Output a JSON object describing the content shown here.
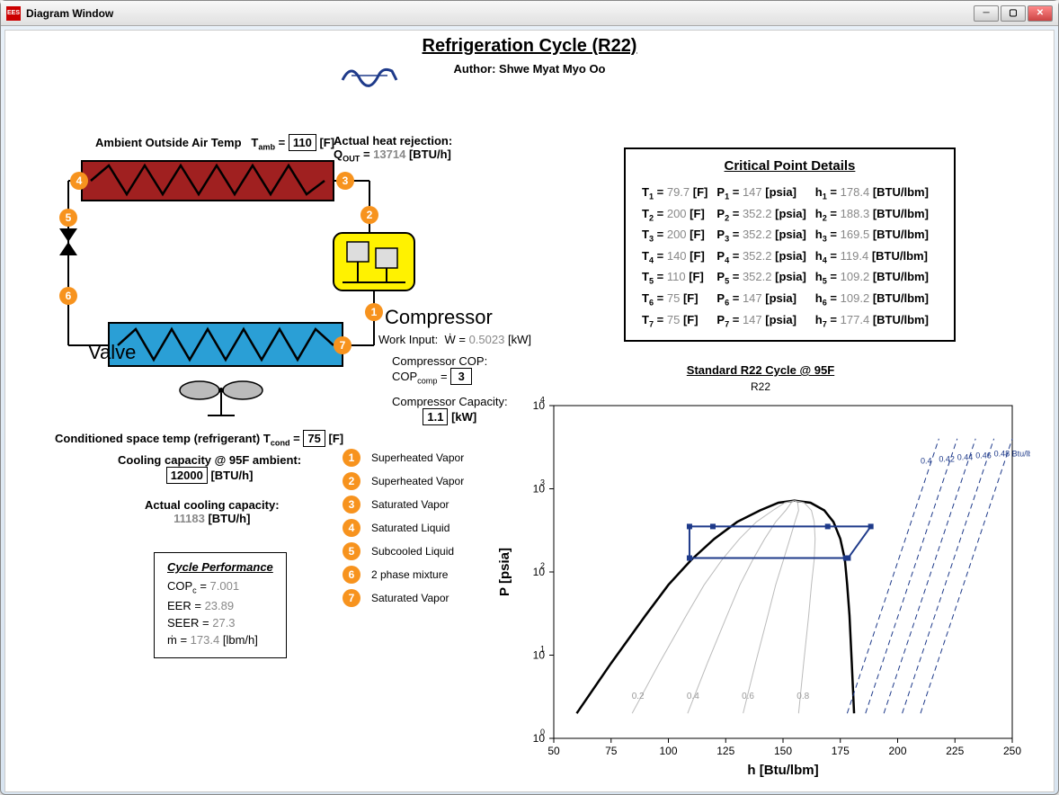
{
  "window": {
    "title": "Diagram Window"
  },
  "header": {
    "title": "Refrigeration Cycle (R22)",
    "author_label": "Author: Shwe Myat Myo Oo"
  },
  "inputs": {
    "ambient_label": "Ambient Outside Air Temp",
    "ambient_symbol": "T",
    "ambient_sub": "amb",
    "ambient_value": "110",
    "ambient_unit": "[F]",
    "heat_rejection_label": "Actual heat rejection:",
    "heat_rejection_symbol": "Q",
    "heat_rejection_sub": "OUT",
    "heat_rejection_value": "13714",
    "heat_rejection_unit": "[BTU/h]",
    "cond_label": "Conditioned space temp (refrigerant)",
    "cond_symbol": "T",
    "cond_sub": "cond",
    "cond_value": "75",
    "cond_unit": "[F]",
    "cooling_cap_label": "Cooling capacity @ 95F ambient:",
    "cooling_cap_value": "12000",
    "cooling_cap_unit": "[BTU/h]",
    "actual_cooling_label": "Actual cooling capacity:",
    "actual_cooling_value": "11183",
    "actual_cooling_unit": "[BTU/h]"
  },
  "components": {
    "valve": "Valve",
    "compressor": "Compressor",
    "work_input_label": "Work Input:",
    "work_input_symbol": "Ẇ",
    "work_input_value": "0.5023",
    "work_input_unit": "[kW]",
    "comp_cop_label": "Compressor COP:",
    "comp_cop_symbol": "COP",
    "comp_cop_sub": "comp",
    "comp_cop_value": "3",
    "comp_cap_label": "Compressor Capacity:",
    "comp_cap_value": "1.1",
    "comp_cap_unit": "[kW]"
  },
  "states": [
    {
      "n": "1",
      "label": "Superheated Vapor"
    },
    {
      "n": "2",
      "label": "Superheated Vapor"
    },
    {
      "n": "3",
      "label": "Saturated Vapor"
    },
    {
      "n": "4",
      "label": "Saturated Liquid"
    },
    {
      "n": "5",
      "label": "Subcooled Liquid"
    },
    {
      "n": "6",
      "label": "2 phase mixture"
    },
    {
      "n": "7",
      "label": "Saturated Vapor"
    }
  ],
  "cycle_performance": {
    "title": "Cycle Performance",
    "copc_label": "COP",
    "copc_sub": "c",
    "copc_value": "7.001",
    "eer_label": "EER",
    "eer_value": "23.89",
    "seer_label": "SEER",
    "seer_value": "27.3",
    "mdot_label": "ṁ",
    "mdot_value": "173.4",
    "mdot_unit": "[lbm/h]"
  },
  "critical": {
    "title": "Critical Point Details",
    "rows": [
      {
        "T": "79.7",
        "P": "147",
        "h": "178.4"
      },
      {
        "T": "200",
        "P": "352.2",
        "h": "188.3"
      },
      {
        "T": "200",
        "P": "352.2",
        "h": "169.5"
      },
      {
        "T": "140",
        "P": "352.2",
        "h": "119.4"
      },
      {
        "T": "110",
        "P": "352.2",
        "h": "109.2"
      },
      {
        "T": "75",
        "P": "147",
        "h": "109.2"
      },
      {
        "T": "75",
        "P": "147",
        "h": "177.4"
      }
    ],
    "T_unit": "[F]",
    "P_unit": "[psia]",
    "h_unit": "[BTU/lbm]"
  },
  "chart": {
    "title": "Standard R22 Cycle @ 95F",
    "subtitle": "R22",
    "xlabel": "h [Btu/lbm]",
    "ylabel": "P [psia]"
  },
  "chart_data": {
    "type": "line",
    "title": "Standard R22 Cycle @ 95F",
    "subtitle": "R22",
    "xlabel": "h [Btu/lbm]",
    "ylabel": "P [psia]",
    "xlim": [
      50,
      250
    ],
    "ylim": [
      1,
      10000
    ],
    "yscale": "log",
    "xticks": [
      50,
      75,
      100,
      125,
      150,
      175,
      200,
      225,
      250
    ],
    "yticks": [
      1,
      10,
      100,
      1000,
      10000
    ],
    "cycle_points": [
      {
        "state": 1,
        "h": 178.4,
        "P": 147
      },
      {
        "state": 2,
        "h": 188.3,
        "P": 352.2
      },
      {
        "state": 3,
        "h": 169.5,
        "P": 352.2
      },
      {
        "state": 4,
        "h": 119.4,
        "P": 352.2
      },
      {
        "state": 5,
        "h": 109.2,
        "P": 352.2
      },
      {
        "state": 6,
        "h": 109.2,
        "P": 147
      },
      {
        "state": 7,
        "h": 177.4,
        "P": 147
      }
    ],
    "quality_lines": [
      0.2,
      0.4,
      0.6,
      0.8
    ],
    "entropy_lines": [
      0.4,
      0.42,
      0.44,
      0.46,
      0.48
    ],
    "entropy_unit": "Btu/lbm-R",
    "saturation_dome": true
  }
}
